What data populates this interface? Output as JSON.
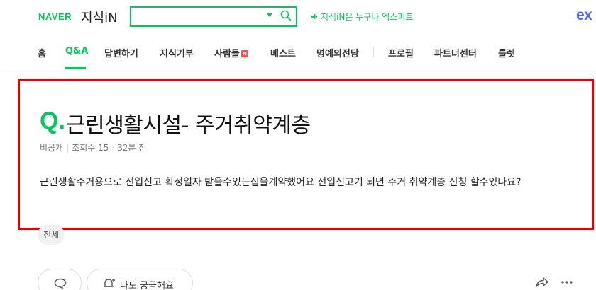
{
  "header": {
    "brand": "NAVER",
    "service": "지식iN",
    "search_placeholder": "",
    "notice": "지식iN은 누구나 엑스퍼트",
    "expert_logo": "ex"
  },
  "nav": {
    "items": [
      {
        "label": "홈"
      },
      {
        "label": "Q&A"
      },
      {
        "label": "답변하기"
      },
      {
        "label": "지식기부"
      },
      {
        "label": "사람들"
      },
      {
        "label": "베스트"
      },
      {
        "label": "명예의전당"
      },
      {
        "label": "프로필"
      },
      {
        "label": "파트너센터"
      },
      {
        "label": "룰렛"
      }
    ],
    "new_badge": "N",
    "active": "Q&A"
  },
  "question": {
    "q_mark": "Q.",
    "title": "근린생활시설- 주거취약계층",
    "author": "비공개",
    "views": "조회수 15",
    "time": "32분 전",
    "body": "근린생활주거용으로 전입신고 확정일자 받을수있는집을계약했어요 전입신고기 되면 주거 취약계층 신청 할수있나요?"
  },
  "tag": "전세",
  "actions": {
    "wonder_label": "나도 궁금해요"
  },
  "colors": {
    "brand_green": "#03c75a",
    "highlight_red": "#e60000",
    "expert_blue": "#4d66ff"
  }
}
